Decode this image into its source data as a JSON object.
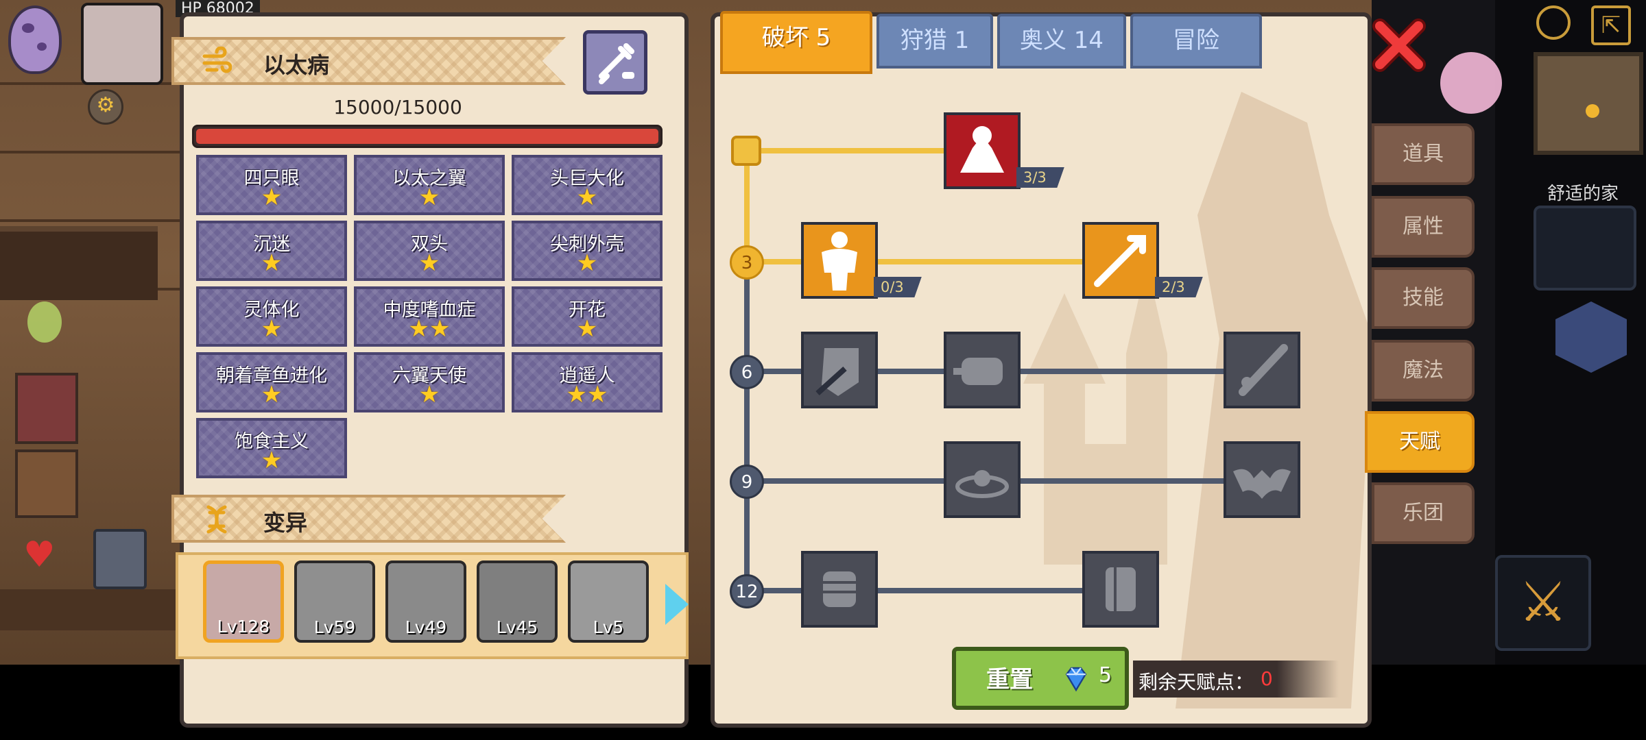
{
  "disease": {
    "title": "以太病",
    "hp_text": "15000/15000",
    "hp_fraction": 1.0,
    "traits": [
      {
        "name": "四只眼",
        "stars": "★"
      },
      {
        "name": "以太之翼",
        "stars": "★"
      },
      {
        "name": "头巨大化",
        "stars": "★"
      },
      {
        "name": "沉迷",
        "stars": "★"
      },
      {
        "name": "双头",
        "stars": "★"
      },
      {
        "name": "尖刺外壳",
        "stars": "★"
      },
      {
        "name": "灵体化",
        "stars": "★"
      },
      {
        "name": "中度嗜血症",
        "stars": "★★"
      },
      {
        "name": "开花",
        "stars": "★"
      },
      {
        "name": "朝着章鱼进化",
        "stars": "★"
      },
      {
        "name": "六翼天使",
        "stars": "★"
      },
      {
        "name": "逍遥人",
        "stars": "★★"
      },
      {
        "name": "饱食主义",
        "stars": "★"
      }
    ]
  },
  "mutation": {
    "title": "变异",
    "pets": [
      "Lv128",
      "Lv59",
      "Lv49",
      "Lv45",
      "Lv5"
    ]
  },
  "tabs": [
    "破坏 5",
    "狩猎 1",
    "奥义 14",
    "冒险"
  ],
  "side_menu": [
    "道具",
    "属性",
    "技能",
    "魔法",
    "天赋",
    "乐团"
  ],
  "tree": {
    "levels": [
      "3",
      "6",
      "9",
      "12"
    ],
    "counts": {
      "arm": "3/3",
      "body": "0/3",
      "arrow": "2/3"
    }
  },
  "reset": {
    "label": "重置",
    "cost": "5"
  },
  "remaining": {
    "label": "剩余天赋点：",
    "value": "0"
  },
  "hud": {
    "home_label": "舒适的家",
    "hp_mini": "HP 68002"
  },
  "colors": {
    "accent": "#f5a521",
    "tab_blue": "#6d87b5",
    "hp_red": "#d9473b",
    "panel": "#f2e4ce"
  }
}
